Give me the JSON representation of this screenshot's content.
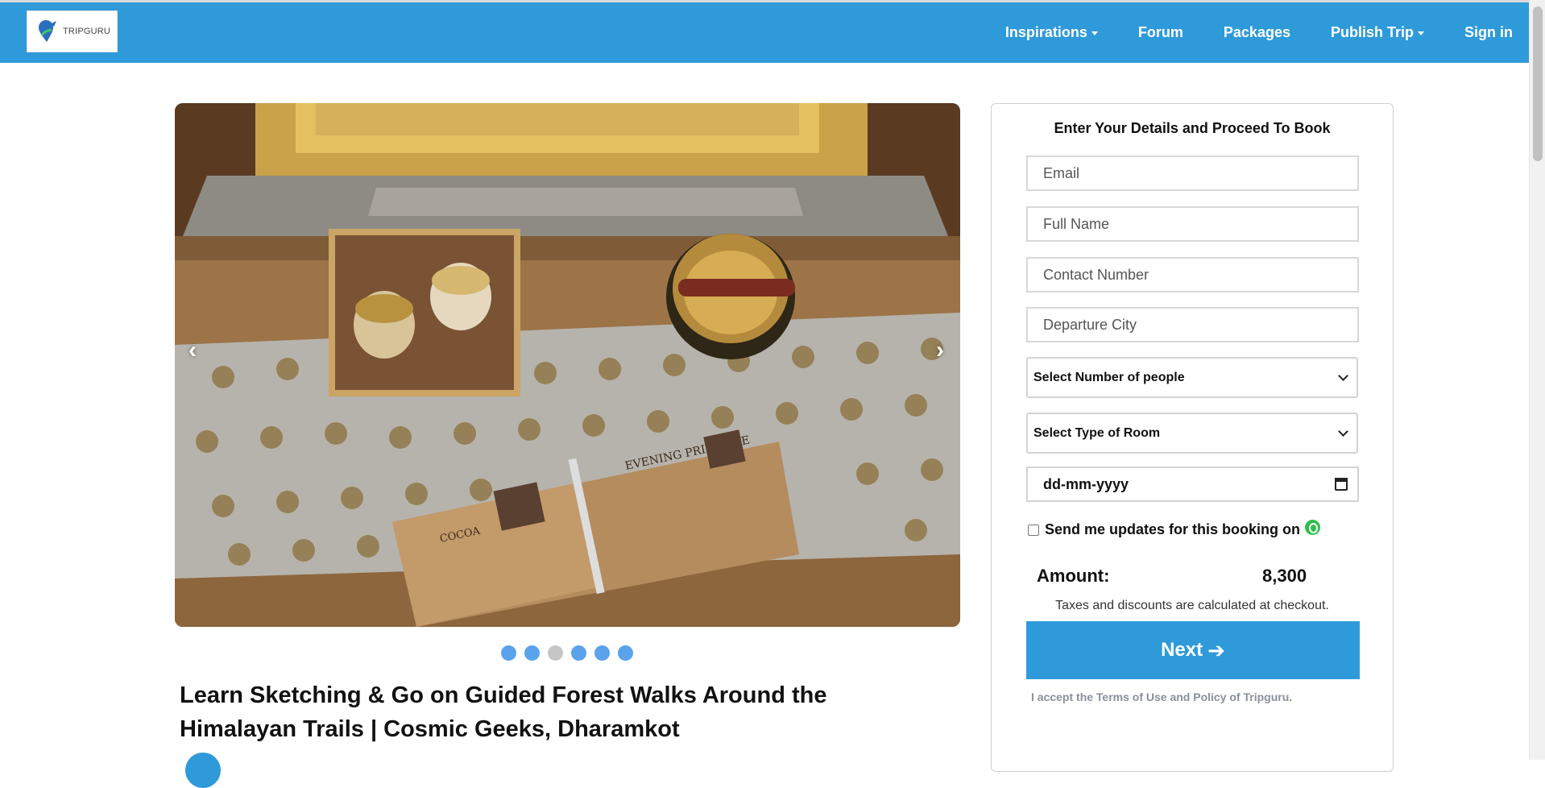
{
  "brand": {
    "logo_text": "TRIPGURU",
    "primary_color": "#2f9ad9"
  },
  "nav": {
    "items": [
      {
        "label": "Inspirations",
        "dropdown": true
      },
      {
        "label": "Forum",
        "dropdown": false
      },
      {
        "label": "Packages",
        "dropdown": false
      },
      {
        "label": "Publish Trip",
        "dropdown": true
      },
      {
        "label": "Sign in",
        "dropdown": false
      }
    ]
  },
  "carousel": {
    "prev_label": "‹",
    "next_label": "›",
    "dots_total": 6,
    "active_dot": 3
  },
  "listing": {
    "title": "Learn Sketching & Go on Guided Forest Walks Around the Himalayan Trails | Cosmic Geeks, Dharamkot"
  },
  "booking": {
    "heading": "Enter Your Details and Proceed To Book",
    "email_placeholder": "Email",
    "name_placeholder": "Full Name",
    "contact_placeholder": "Contact Number",
    "city_placeholder": "Departure City",
    "people_select": "Select Number of people",
    "room_select": "Select Type of Room",
    "date_placeholder": "dd-mm-yyyy",
    "updates_label": "Send me updates for this booking on",
    "amount_label": "Amount:",
    "amount_value": "8,300",
    "tax_note": "Taxes and discounts are calculated at checkout.",
    "next_label": "Next",
    "terms_text": "I accept the Terms of Use and Policy of Tripguru."
  }
}
